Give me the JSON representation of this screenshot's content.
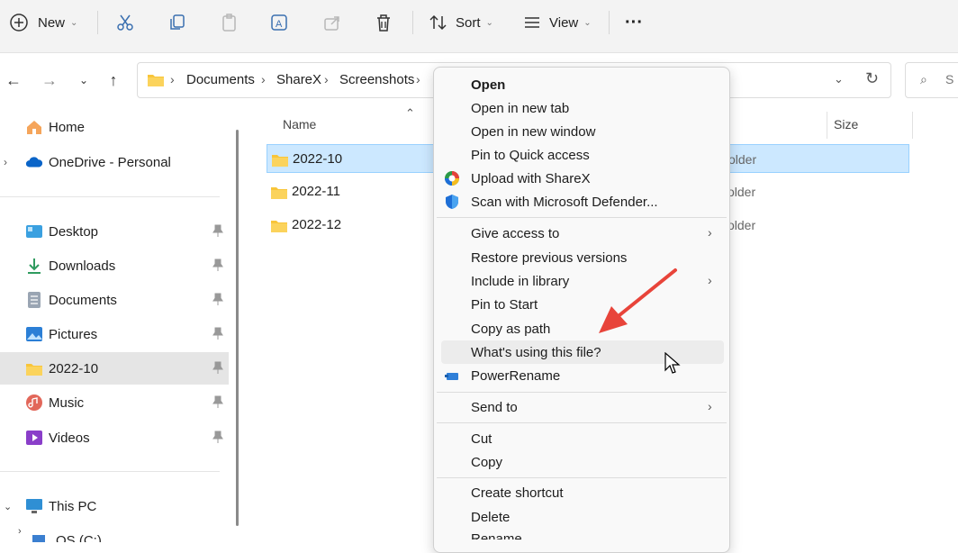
{
  "toolbar": {
    "new_label": "New",
    "sort_label": "Sort",
    "view_label": "View",
    "more_label": "···"
  },
  "address": {
    "crumbs": [
      "Documents",
      "ShareX",
      "Screenshots"
    ],
    "search_placeholder": "S"
  },
  "sidebar": {
    "home": "Home",
    "onedrive": "OneDrive - Personal",
    "quick": [
      "Desktop",
      "Downloads",
      "Documents",
      "Pictures",
      "2022-10",
      "Music",
      "Videos"
    ],
    "thispc": "This PC",
    "drive": "OS (C:)"
  },
  "columns": {
    "name": "Name",
    "size": "Size"
  },
  "files": [
    {
      "name": "2022-10",
      "type": "older"
    },
    {
      "name": "2022-11",
      "type": "older"
    },
    {
      "name": "2022-12",
      "type": "older"
    }
  ],
  "menu": {
    "open": "Open",
    "open_new_tab": "Open in new tab",
    "open_new_window": "Open in new window",
    "pin_quick": "Pin to Quick access",
    "upload_sharex": "Upload with ShareX",
    "scan_defender": "Scan with Microsoft Defender...",
    "give_access": "Give access to",
    "restore_prev": "Restore previous versions",
    "include_library": "Include in library",
    "pin_start": "Pin to Start",
    "copy_path": "Copy as path",
    "whats_using": "What's using this file?",
    "power_rename": "PowerRename",
    "send_to": "Send to",
    "cut": "Cut",
    "copy": "Copy",
    "create_shortcut": "Create shortcut",
    "delete": "Delete",
    "rename": "Rename"
  },
  "colors": {
    "folder": "#f8c53a",
    "selection": "#cce8ff",
    "arrow": "#e8443a",
    "accent": "#0067c0"
  }
}
